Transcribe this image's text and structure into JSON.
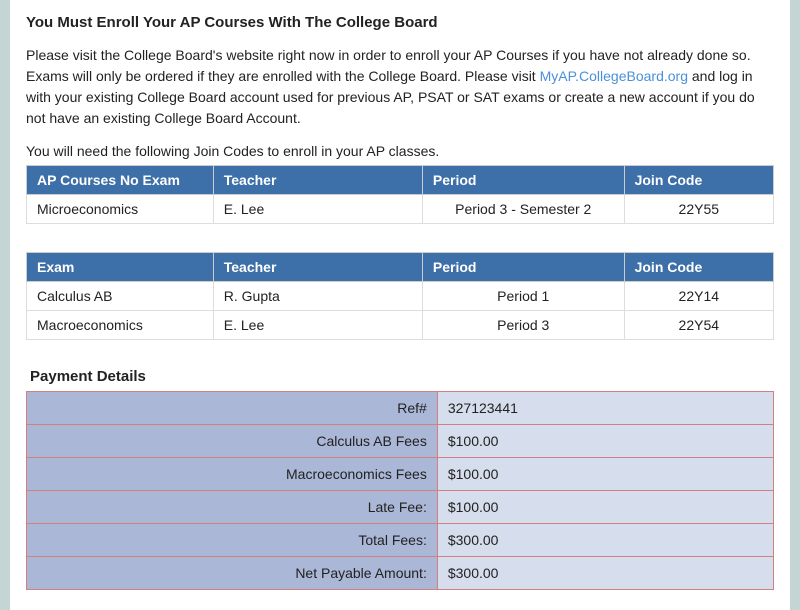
{
  "heading": "You Must Enroll Your AP Courses With The College Board",
  "intro_pre": "Please visit the College Board's website right now in order to enroll your AP Courses if you have not already done so. Exams will only be ordered if they are enrolled with the College Board. Please visit ",
  "intro_link": "MyAP.CollegeBoard.org",
  "intro_post": " and log in with your existing College Board account used for previous AP, PSAT or SAT exams or create a new account if you do not have an existing College Board Account.",
  "note": "You will need the following Join Codes to enroll in your AP classes.",
  "table1": {
    "headers": {
      "course": "AP Courses No Exam",
      "teacher": "Teacher",
      "period": "Period",
      "code": "Join Code"
    },
    "rows": [
      {
        "course": "Microeconomics",
        "teacher": "E. Lee",
        "period": "Period 3 - Semester 2",
        "code": "22Y55"
      }
    ]
  },
  "table2": {
    "headers": {
      "course": "Exam",
      "teacher": "Teacher",
      "period": "Period",
      "code": "Join Code"
    },
    "rows": [
      {
        "course": "Calculus AB",
        "teacher": "R. Gupta",
        "period": "Period 1",
        "code": "22Y14"
      },
      {
        "course": "Macroeconomics",
        "teacher": "E. Lee",
        "period": "Period 3",
        "code": "22Y54"
      }
    ]
  },
  "payment": {
    "title": "Payment Details",
    "rows": [
      {
        "label": "Ref#",
        "value": "327123441"
      },
      {
        "label": "Calculus AB Fees",
        "value": "$100.00"
      },
      {
        "label": "Macroeconomics Fees",
        "value": "$100.00"
      },
      {
        "label": "Late Fee:",
        "value": "$100.00"
      },
      {
        "label": "Total Fees:",
        "value": "$300.00"
      },
      {
        "label": "Net Payable Amount:",
        "value": "$300.00"
      }
    ]
  }
}
